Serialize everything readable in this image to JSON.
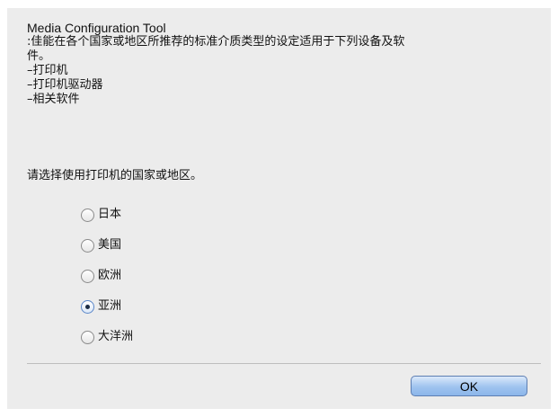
{
  "dialog": {
    "title": "Media Configuration Tool",
    "description_lines": [
      ":佳能在各个国家或地区所推荐的标准介质类型的设定适用于下列设备及软",
      "件。",
      "–打印机",
      "–打印机驱动器",
      "–相关软件"
    ],
    "prompt": "请选择使用打印机的国家或地区。",
    "regions": [
      {
        "label": "日本",
        "selected": false
      },
      {
        "label": "美国",
        "selected": false
      },
      {
        "label": "欧洲",
        "selected": false
      },
      {
        "label": "亚洲",
        "selected": true
      },
      {
        "label": "大洋洲",
        "selected": false
      }
    ],
    "ok_label": "OK"
  }
}
